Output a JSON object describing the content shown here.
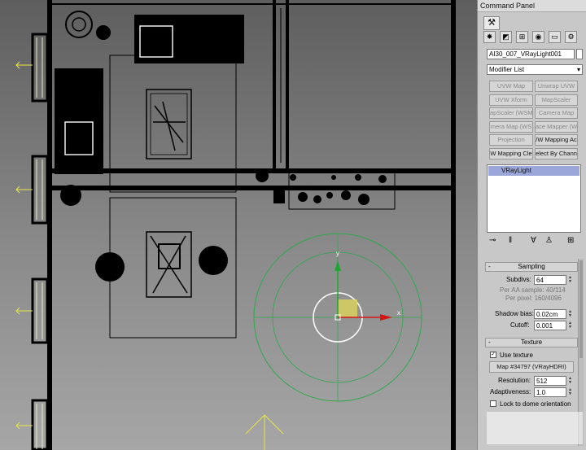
{
  "panel": {
    "title": "Command Panel",
    "tabs": [
      "create-tab",
      "modify-tab",
      "hierarchy-tab",
      "motion-tab",
      "display-tab",
      "utilities-tab"
    ],
    "object_name": "AI30_007_VRayLight001",
    "modifier_list": "Modifier List",
    "modifier_buttons": [
      {
        "label": "UVW Map",
        "enabled": false
      },
      {
        "label": "Unwrap UVW",
        "enabled": false
      },
      {
        "label": "UVW Xform",
        "enabled": false
      },
      {
        "label": "MapScaler",
        "enabled": false
      },
      {
        "label": "apScaler (WSM",
        "enabled": false
      },
      {
        "label": "Camera Map",
        "enabled": false
      },
      {
        "label": "mera Map (WS",
        "enabled": false
      },
      {
        "label": "ace Mapper (W",
        "enabled": false
      },
      {
        "label": "Projection",
        "enabled": false
      },
      {
        "label": "/W Mapping Ac",
        "enabled": true
      },
      {
        "label": "W Mapping Cle",
        "enabled": true
      },
      {
        "label": "elect By Chann",
        "enabled": true
      }
    ],
    "stack_item": "VRayLight",
    "stack_icons": [
      "pin-stack-icon",
      "show-end-result-icon",
      "make-unique-icon",
      "remove-modifier-icon",
      "configure-sets-icon"
    ]
  },
  "sampling": {
    "title": "Sampling",
    "subdivs_label": "Subdivs:",
    "subdivs_value": "64",
    "per_aa": "Per AA sample: 40/114",
    "per_pixel": "Per pixel: 160/4096",
    "shadow_bias_label": "Shadow bias:",
    "shadow_bias_value": "0.02cm",
    "cutoff_label": "Cutoff:",
    "cutoff_value": "0.001"
  },
  "texture": {
    "title": "Texture",
    "use_texture_label": "Use texture",
    "use_texture_checked": true,
    "map_button": "Map #34797  (VRayHDRI)",
    "resolution_label": "Resolution:",
    "resolution_value": "512",
    "adaptiveness_label": "Adaptiveness:",
    "adaptiveness_value": "1.0",
    "lock_label": "Lock to dome orientation",
    "lock_checked": false
  },
  "viewport": {
    "gizmo_x_label": "x",
    "gizmo_y_label": "y",
    "colors": {
      "floorplan": "#000000",
      "windows": "#e8e8c0",
      "ring": "#2fa84f",
      "axis_x": "#d41616",
      "axis_y": "#1fa82f",
      "arrow": "#e6e64a"
    }
  }
}
